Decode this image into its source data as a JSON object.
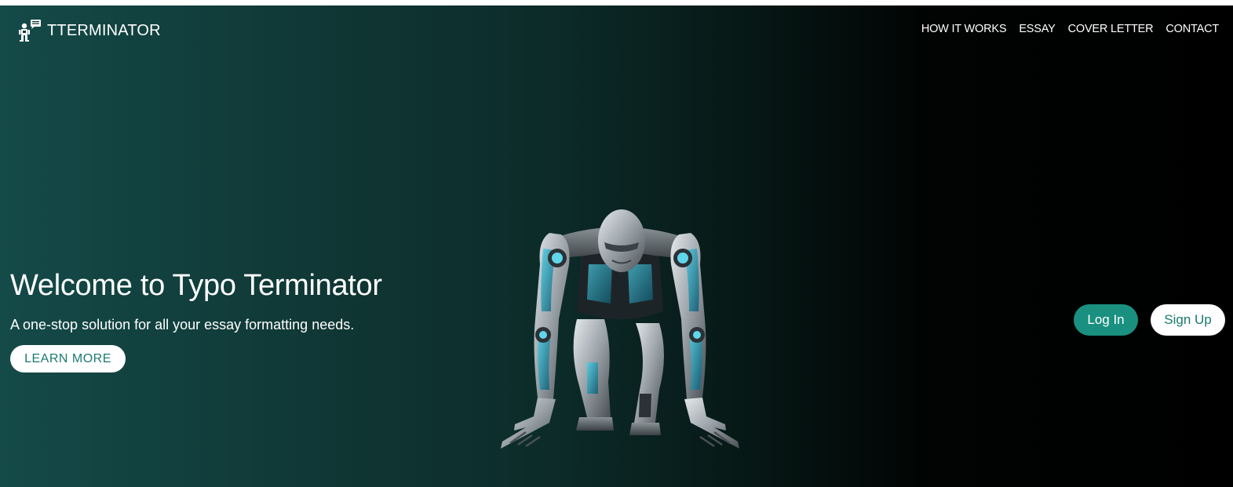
{
  "brand": {
    "name": "TTERMINATOR",
    "logo_icon": "robot-speech-bubble-icon"
  },
  "nav": {
    "items": [
      "HOW IT WORKS",
      "ESSAY",
      "COVER LETTER",
      "CONTACT"
    ]
  },
  "hero": {
    "title": "Welcome to Typo Terminator",
    "subtitle": "A one-stop solution for all your essay formatting needs.",
    "cta_label": "LEARN MORE",
    "illustration": "crouching-robot-illustration"
  },
  "auth": {
    "login_label": "Log In",
    "signup_label": "Sign Up"
  },
  "colors": {
    "gradient_start": "#144a48",
    "gradient_end": "#000000",
    "accent": "#1a9080",
    "accent_text": "#1a7a70"
  }
}
